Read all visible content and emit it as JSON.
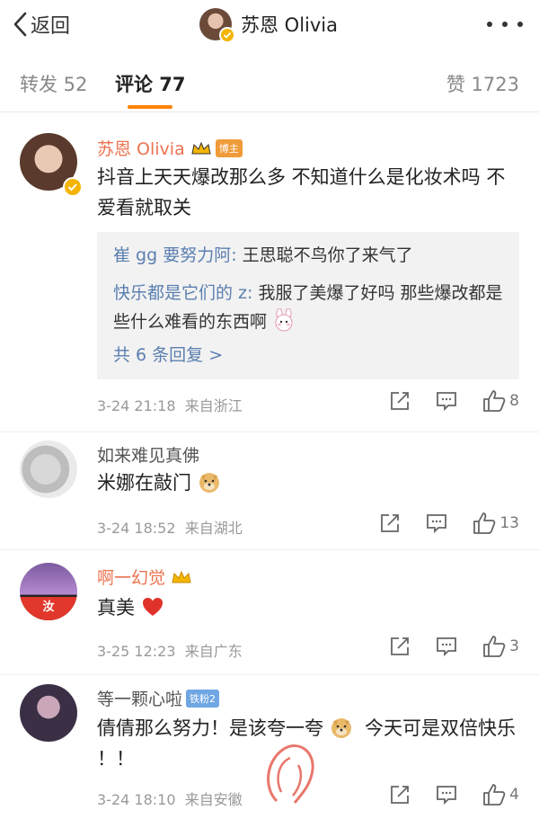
{
  "header": {
    "back_label": "返回",
    "title": "苏恩 Olivia"
  },
  "tabs": {
    "repost": "转发 52",
    "comments": "评论 77",
    "likes": "赞 1723"
  },
  "comments": [
    {
      "username": "苏恩 Olivia",
      "badge": "博主",
      "text": "抖音上天天爆改那么多 不知道什么是化妆术吗 不爱看就取关",
      "replies": [
        {
          "name": "崔 gg 要努力阿",
          "text": "王思聪不鸟你了来气了"
        },
        {
          "name": "快乐都是它们的 z",
          "text": "我服了美爆了好吗 那些爆改都是些什么难看的东西啊"
        }
      ],
      "more_replies": "共 6 条回复 >",
      "time": "3-24 21:18",
      "location": "来自浙江",
      "likes": "8"
    },
    {
      "username": "如来难见真佛",
      "text": "米娜在敲门",
      "time": "3-24 18:52",
      "location": "来自湖北",
      "likes": "13"
    },
    {
      "username": "啊一幻觉",
      "text": "真美",
      "avatar_text": "汝",
      "time": "3-25 12:23",
      "location": "来自广东",
      "likes": "3"
    },
    {
      "username": "等一颗心啦",
      "badge": "铁粉2",
      "text_a": "倩倩那么努力！是该夸一夸",
      "text_b": "今天可是双倍快乐 ！！",
      "time": "3-24 18:10",
      "location": "来自安徽",
      "likes": "4"
    }
  ],
  "colors": {
    "accent": "#ff8200",
    "username_orange": "#eb7350",
    "reply_name_blue": "#5b7fb0",
    "reply_bg": "#f2f2f2"
  }
}
